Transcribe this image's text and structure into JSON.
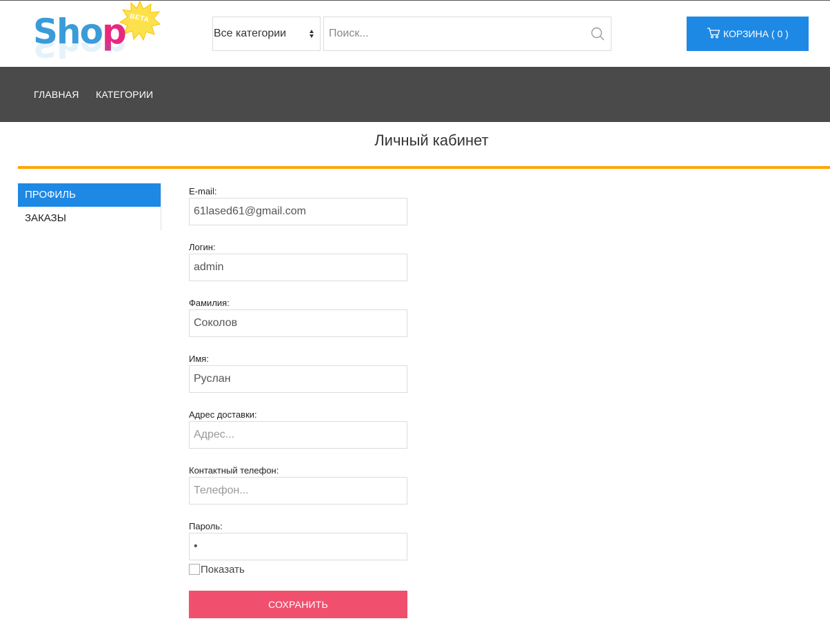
{
  "header": {
    "logo_text_shop": "Shop",
    "logo_badge": "BETA",
    "category_select_value": "Все категории",
    "search_placeholder": "Поиск...",
    "cart_label": "КОРЗИНА ( 0 )"
  },
  "nav": {
    "items": [
      "ГЛАВНАЯ",
      "КАТЕГОРИИ"
    ]
  },
  "page": {
    "title": "Личный кабинет"
  },
  "sidebar": {
    "items": [
      {
        "label": "ПРОФИЛЬ",
        "active": true
      },
      {
        "label": "ЗАКАЗЫ",
        "active": false
      }
    ]
  },
  "form": {
    "email": {
      "label": "E-mail:",
      "value": "61lased61@gmail.com",
      "placeholder": ""
    },
    "login": {
      "label": "Логин:",
      "value": "admin",
      "placeholder": ""
    },
    "surname": {
      "label": "Фамилия:",
      "value": "Соколов",
      "placeholder": ""
    },
    "name": {
      "label": "Имя:",
      "value": "Руслан",
      "placeholder": ""
    },
    "address": {
      "label": "Адрес доставки:",
      "value": "",
      "placeholder": "Адрес..."
    },
    "phone": {
      "label": "Контактный телефон:",
      "value": "",
      "placeholder": "Телефон..."
    },
    "password": {
      "label": "Пароль:",
      "value": "•",
      "placeholder": ""
    },
    "show_password_label": "Показать",
    "save_label": "СОХРАНИТЬ"
  },
  "colors": {
    "accent_blue": "#1e88e5",
    "nav_bg": "#4a4a4a",
    "title_rule": "#ffa500",
    "save_button": "#f0506e"
  }
}
